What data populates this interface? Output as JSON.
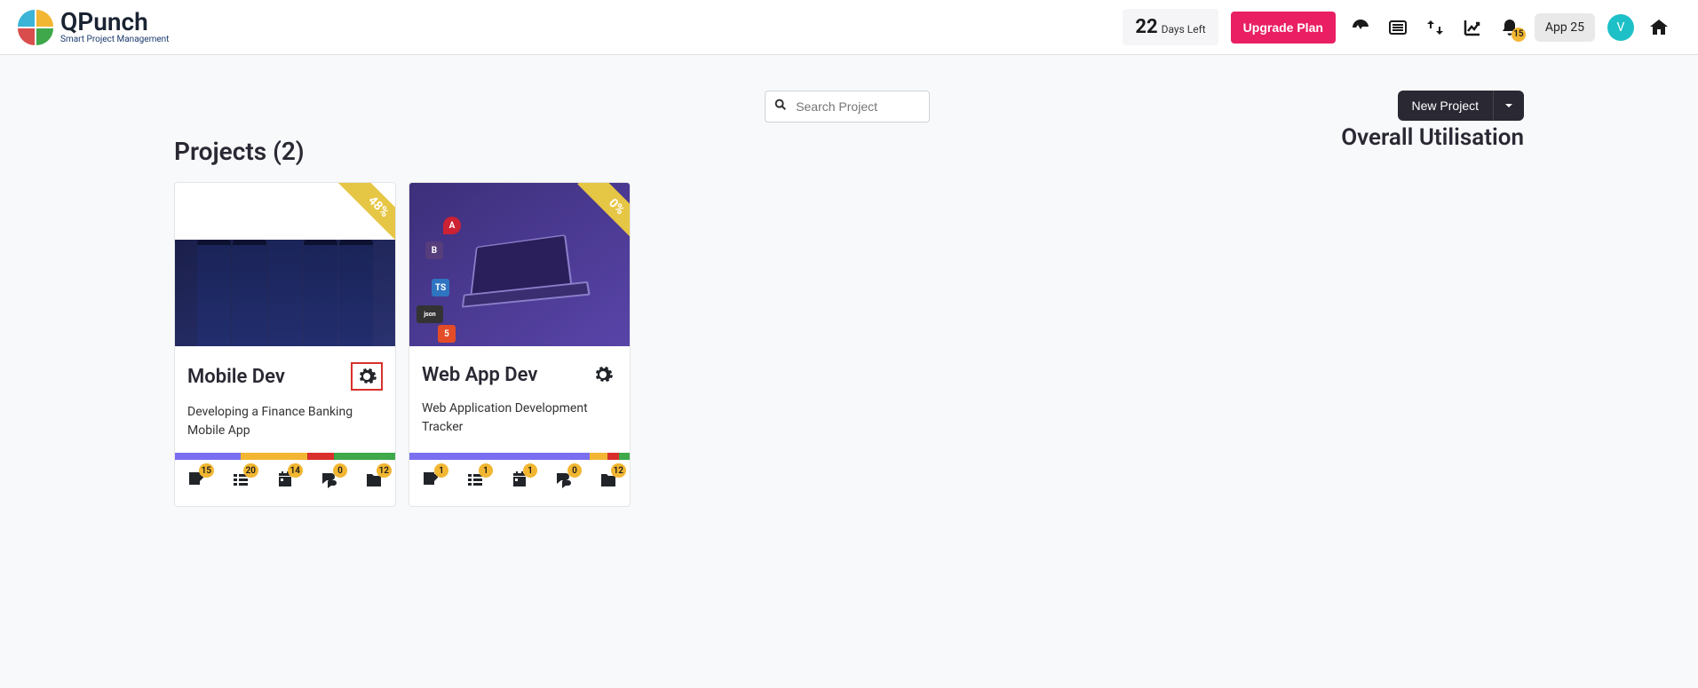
{
  "header": {
    "brand": "QPunch",
    "tagline": "Smart Project Management",
    "days_count": "22",
    "days_label": "Days Left",
    "upgrade_label": "Upgrade Plan",
    "notif_count": "15",
    "app_badge": "App 25",
    "avatar_initial": "V"
  },
  "search": {
    "placeholder": "Search Project"
  },
  "new_project_label": "New Project",
  "projects_title": "Projects (2)",
  "utilisation_title": "Overall Utilisation",
  "projects": [
    {
      "progress_ribbon": "48%",
      "name": "Mobile Dev",
      "description": "Developing a Finance Banking Mobile App",
      "gear_highlight": true,
      "segments": [
        {
          "color": "#7a6ff0",
          "pct": 30
        },
        {
          "color": "#f2b632",
          "pct": 30
        },
        {
          "color": "#d9302c",
          "pct": 12
        },
        {
          "color": "#3ea84a",
          "pct": 28
        }
      ],
      "stats": {
        "boards": "15",
        "tasks": "20",
        "calendar": "14",
        "chat": "0",
        "files": "12"
      }
    },
    {
      "progress_ribbon": "0%",
      "name": "Web App Dev",
      "description": "Web Application Development Tracker",
      "gear_highlight": false,
      "segments": [
        {
          "color": "#7a6ff0",
          "pct": 82
        },
        {
          "color": "#f2b632",
          "pct": 8
        },
        {
          "color": "#d9302c",
          "pct": 5
        },
        {
          "color": "#3ea84a",
          "pct": 5
        }
      ],
      "stats": {
        "boards": "1",
        "tasks": "1",
        "calendar": "1",
        "chat": "0",
        "files": "12"
      }
    }
  ]
}
